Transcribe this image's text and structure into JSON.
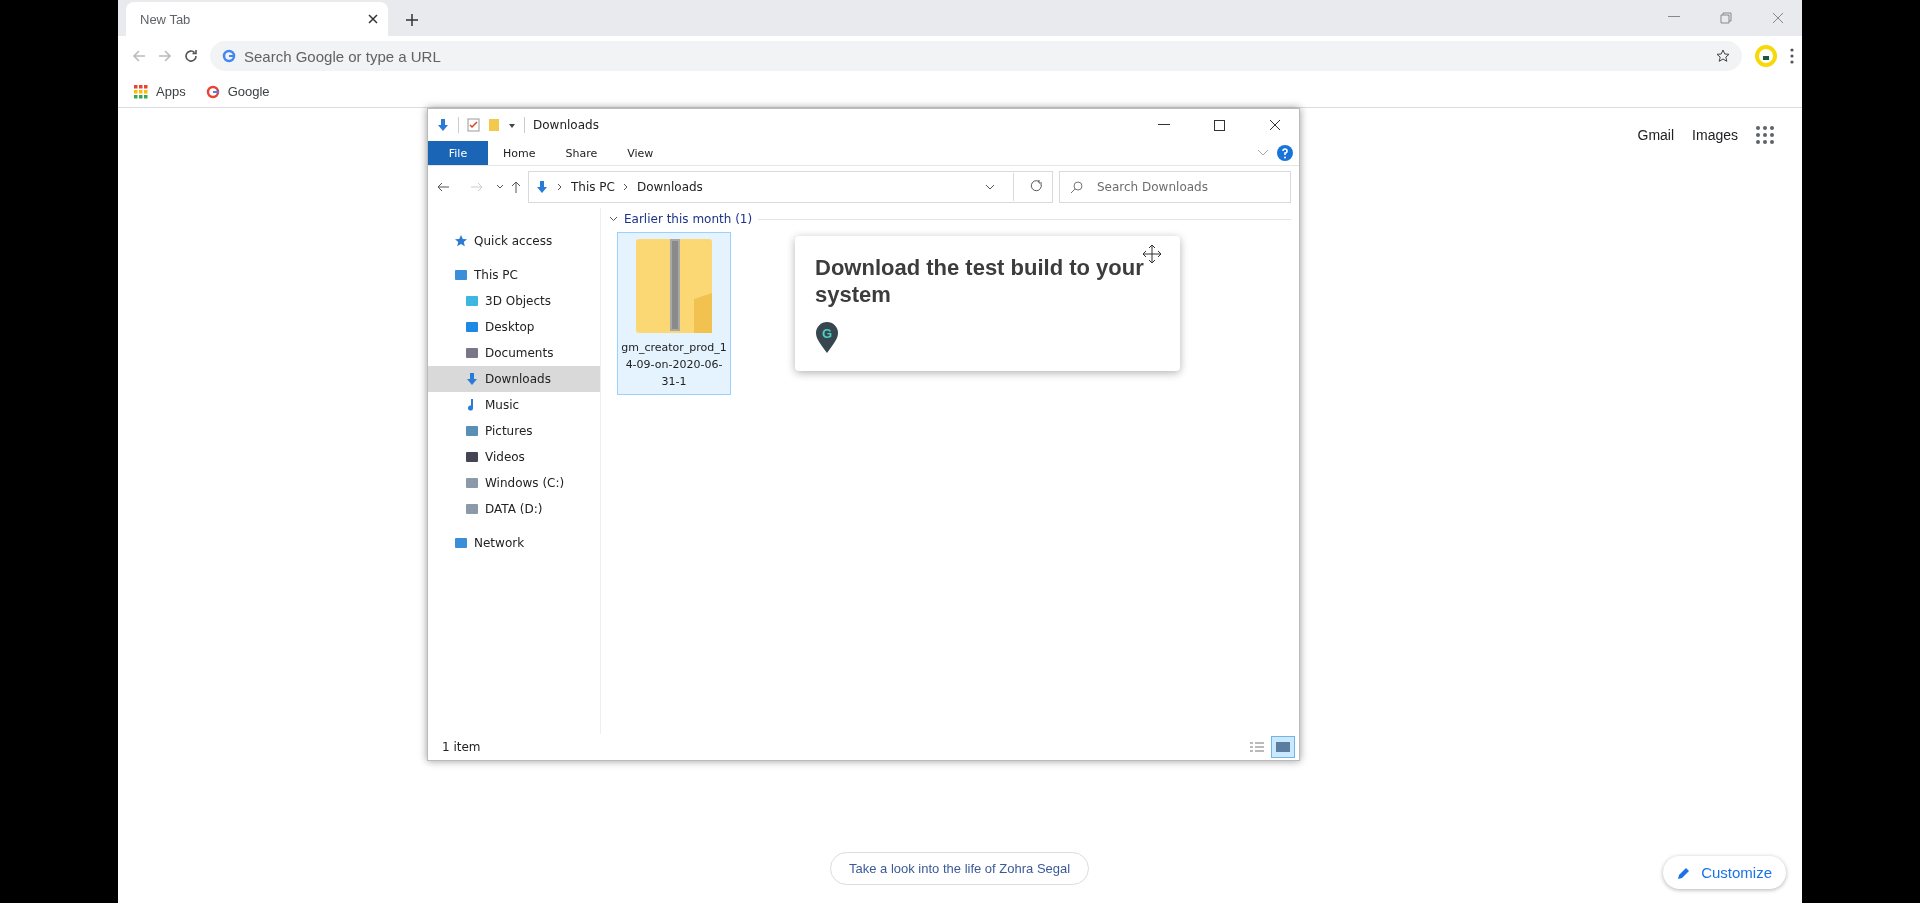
{
  "browser": {
    "tabs": [
      {
        "title": "New Tab",
        "selected": true
      }
    ],
    "omnibox": {
      "placeholder": "Search Google or type a URL"
    },
    "bookmarks": [
      {
        "label": "Apps"
      },
      {
        "label": "Google"
      }
    ]
  },
  "ntp": {
    "links": [
      "Gmail",
      "Images"
    ],
    "footer_pill": "Take a look into the life of Zohra Segal",
    "customize": "Customize"
  },
  "explorer": {
    "title": "Downloads",
    "ribbon_tabs": [
      {
        "label": "File",
        "selected": true
      },
      {
        "label": "Home",
        "selected": false
      },
      {
        "label": "Share",
        "selected": false
      },
      {
        "label": "View",
        "selected": false
      }
    ],
    "breadcrumb": [
      "This PC",
      "Downloads"
    ],
    "search": {
      "placeholder": "Search Downloads"
    },
    "sidebar": [
      {
        "label": "Quick access",
        "selected": false
      },
      {
        "label": "This PC",
        "selected": false,
        "children": [
          {
            "label": "3D Objects",
            "selected": false
          },
          {
            "label": "Desktop",
            "selected": false
          },
          {
            "label": "Documents",
            "selected": false
          },
          {
            "label": "Downloads",
            "selected": true
          },
          {
            "label": "Music",
            "selected": false
          },
          {
            "label": "Pictures",
            "selected": false
          },
          {
            "label": "Videos",
            "selected": false
          },
          {
            "label": "Windows (C:)",
            "selected": false
          },
          {
            "label": "DATA (D:)",
            "selected": false
          }
        ]
      },
      {
        "label": "Network",
        "selected": false
      }
    ],
    "group_header": "Earlier this month (1)",
    "files": [
      {
        "name": "gm_creator_prod_14-09-on-2020-06-31-1",
        "selected": true
      }
    ],
    "status": "1 item"
  },
  "tooltip": {
    "title": "Download the test build to your system",
    "badge": "G"
  }
}
